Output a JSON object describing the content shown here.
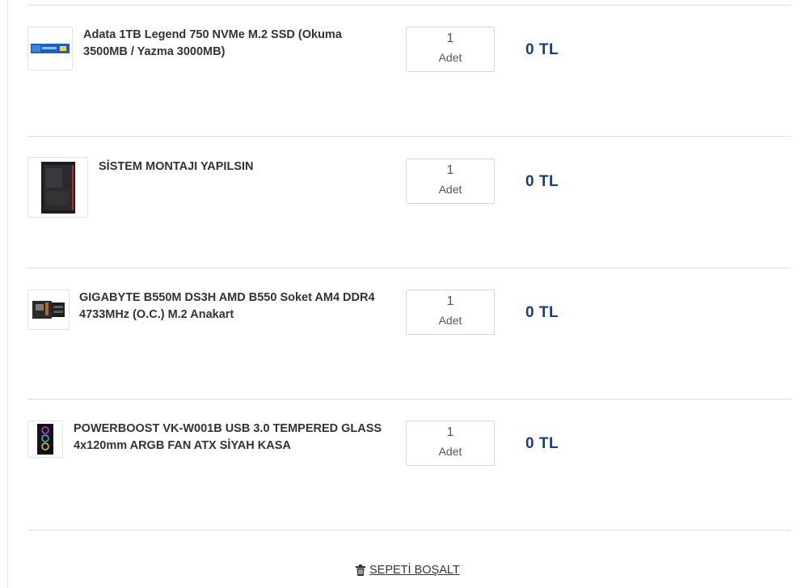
{
  "cart": {
    "items": [
      {
        "title": "Adata 1TB Legend 750 NVMe M.2 SSD (Okuma 3500MB / Yazma 3000MB)",
        "quantity": "1",
        "unit": "Adet",
        "price": "0 TL",
        "icon": "ssd-image"
      },
      {
        "title": "SİSTEM MONTAJI YAPILSIN",
        "quantity": "1",
        "unit": "Adet",
        "price": "0 TL",
        "icon": "pc-case-image"
      },
      {
        "title": "GIGABYTE B550M DS3H AMD B550 Soket AM4 DDR4 4733MHz (O.C.) M.2 Anakart",
        "quantity": "1",
        "unit": "Adet",
        "price": "0 TL",
        "icon": "motherboard-image"
      },
      {
        "title": "POWERBOOST VK-W001B USB 3.0 TEMPERED GLASS 4x120mm ARGB FAN ATX SİYAH KASA",
        "quantity": "1",
        "unit": "Adet",
        "price": "0 TL",
        "icon": "argb-case-image"
      }
    ],
    "empty_cart_label": "SEPETİ BOŞALT",
    "empty_cart_icon": "trash-icon"
  },
  "colors": {
    "price": "#1a3d7c",
    "divider": "#dcdcdc"
  }
}
